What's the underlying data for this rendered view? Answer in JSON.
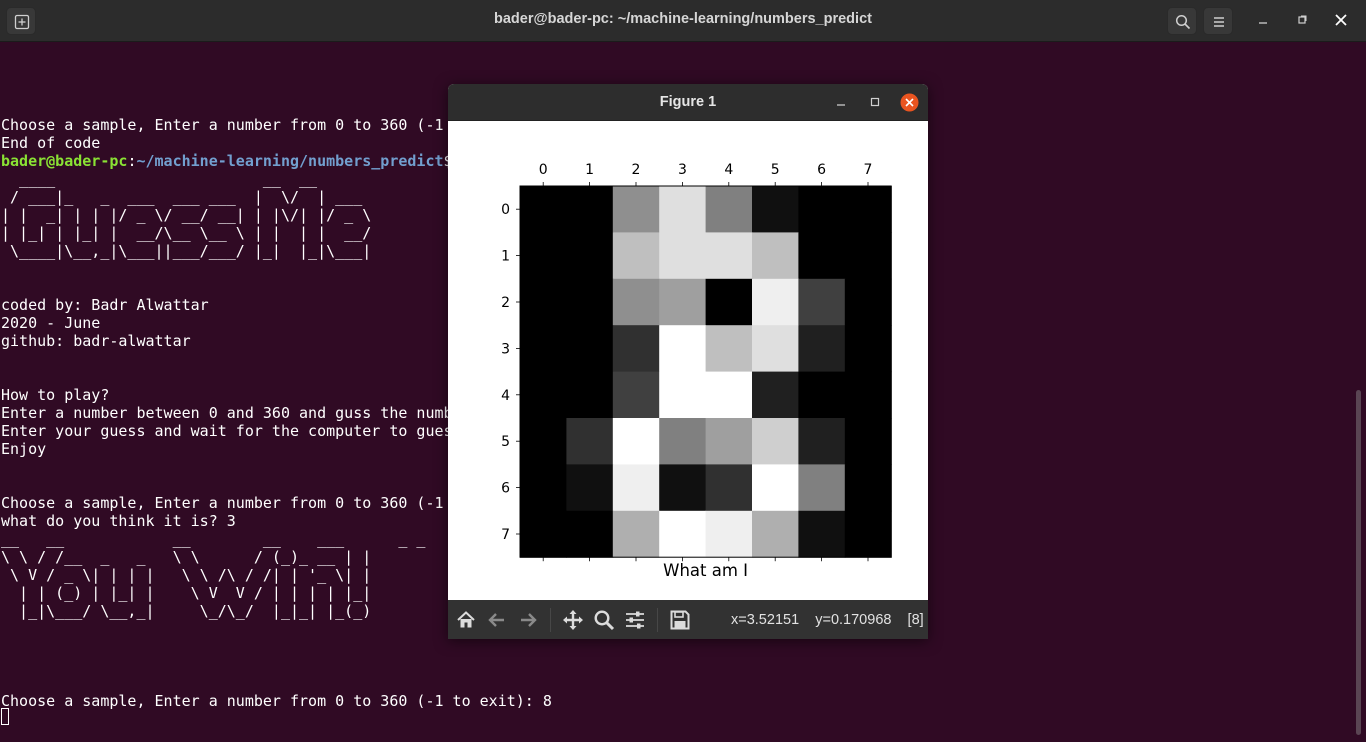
{
  "terminal": {
    "title": "bader@bader-pc: ~/machine-learning/numbers_predict",
    "lines": [
      {
        "text": "Choose a sample, Enter a number from 0 to 360 (-1"
      },
      {
        "text": "End of code"
      },
      {
        "prompt_user": "bader@bader-pc",
        "prompt_sep": ":",
        "prompt_path": "~/machine-learning/numbers_predict",
        "prompt_end": "$"
      },
      {
        "text": "  ____                       __  __"
      },
      {
        "text": " / ___|_   _  ___  ___ ___  |  \\/  | ___"
      },
      {
        "text": "| |  _| | | |/ _ \\/ __/ __| | |\\/| |/ _ \\"
      },
      {
        "text": "| |_| | |_| |  __/\\__ \\__ \\ | |  | |  __/"
      },
      {
        "text": " \\____|\\__,_|\\___||___/___/ |_|  |_|\\___|"
      },
      {
        "text": ""
      },
      {
        "text": ""
      },
      {
        "text": "coded by: Badr Alwattar"
      },
      {
        "text": "2020 - June"
      },
      {
        "text": "github: badr-alwattar"
      },
      {
        "text": ""
      },
      {
        "text": ""
      },
      {
        "text": "How to play?"
      },
      {
        "text": "Enter a number between 0 and 360 and guss the numb"
      },
      {
        "text": "Enter your guess and wait for the computer to gues"
      },
      {
        "text": "Enjoy"
      },
      {
        "text": ""
      },
      {
        "text": ""
      },
      {
        "text": "Choose a sample, Enter a number from 0 to 360 (-1"
      },
      {
        "text": "what do you think it is? 3"
      },
      {
        "text": "__   __            __        __    ___      _ _"
      },
      {
        "text": "\\ \\ / /__  _   _   \\ \\      / (_)_ __ | |"
      },
      {
        "text": " \\ V / _ \\| | | |   \\ \\ /\\ / /| | '_ \\| |"
      },
      {
        "text": "  | | (_) | |_| |    \\ V  V / | | | | |_|"
      },
      {
        "text": "  |_|\\___/ \\__,_|     \\_/\\_/  |_|_| |_(_)"
      },
      {
        "text": ""
      },
      {
        "text": ""
      },
      {
        "text": ""
      },
      {
        "text": ""
      },
      {
        "text": "Choose a sample, Enter a number from 0 to 360 (-1 to exit): 8"
      }
    ]
  },
  "figure": {
    "title": "Figure 1",
    "coords_text": "x=3.52151    y=0.170968    [8]",
    "toolbar_icons": [
      "home-icon",
      "back-arrow-icon",
      "forward-arrow-icon",
      "pan-move-icon",
      "zoom-magnifier-icon",
      "configure-subplots-icon",
      "save-disk-icon"
    ]
  },
  "chart_data": {
    "type": "heatmap",
    "title": "",
    "xlabel": "What am I",
    "ylabel": "",
    "colormap": "gray",
    "x_ticks": [
      0,
      1,
      2,
      3,
      4,
      5,
      6,
      7
    ],
    "y_ticks": [
      0,
      1,
      2,
      3,
      4,
      5,
      6,
      7
    ],
    "x_axis_position": "top",
    "value_range": [
      0,
      16
    ],
    "grid": false,
    "values": [
      [
        0,
        0,
        9,
        14,
        8,
        1,
        0,
        0
      ],
      [
        0,
        0,
        12,
        14,
        14,
        12,
        0,
        0
      ],
      [
        0,
        0,
        9,
        10,
        0,
        15,
        4,
        0
      ],
      [
        0,
        0,
        3,
        16,
        12,
        14,
        2,
        0
      ],
      [
        0,
        0,
        4,
        16,
        16,
        2,
        0,
        0
      ],
      [
        0,
        3,
        16,
        8,
        10,
        13,
        2,
        0
      ],
      [
        0,
        1,
        15,
        1,
        3,
        16,
        8,
        0
      ],
      [
        0,
        0,
        11,
        16,
        15,
        11,
        1,
        0
      ]
    ]
  }
}
